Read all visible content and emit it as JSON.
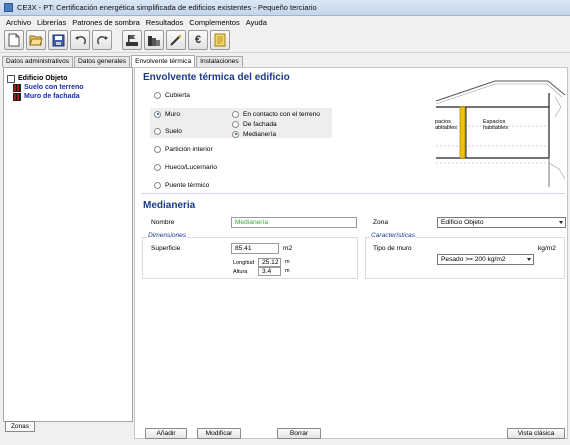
{
  "window": {
    "title": "CE3X - PT: Certificación energética simplificada de edificios existentes - Pequeño terciario"
  },
  "menu": [
    "Archivo",
    "Librerías",
    "Patrones de sombra",
    "Resultados",
    "Complementos",
    "Ayuda"
  ],
  "toolbar": {
    "icons": [
      "new-file-icon",
      "open-folder-icon",
      "save-icon",
      "undo-icon",
      "redo-icon",
      "building-flag-icon",
      "building-levels-icon",
      "magic-wand-icon",
      "euro-icon",
      "document-icon"
    ],
    "euro_symbol": "€"
  },
  "tabs": [
    "Datos administrativos",
    "Datos generales",
    "Envolvente térmica",
    "Instalaciones"
  ],
  "active_tab": "Envolvente térmica",
  "tree": {
    "root": "Edificio Objeto",
    "children": [
      "Suelo con terreno",
      "Muro de fachada"
    ]
  },
  "zonas_button": "Zonas",
  "envelope": {
    "title": "Envolvente térmica del edificio",
    "options": [
      "Cubierta",
      "Muro",
      "Suelo",
      "Partición interior",
      "Hueco/Lucernario",
      "Puente térmico"
    ],
    "selected": "Muro",
    "muro_suboptions": [
      "En contacto con el terreno",
      "De fachada",
      "Medianería"
    ],
    "muro_selected": "Medianería",
    "diagram_labels": {
      "left": [
        "pacios",
        "abitables"
      ],
      "right": [
        "Espacios",
        "habitables"
      ]
    }
  },
  "detail": {
    "title": "Medianeria",
    "nombre_label": "Nombre",
    "nombre_value": "Medianería",
    "zona_label": "Zona",
    "zona_value": "Edificio Objeto",
    "dimensiones_legend": "Dimensiones",
    "superficie_label": "Superficie",
    "superficie_value": "85.41",
    "superficie_unit": "m2",
    "longitud_label": "Longitud",
    "longitud_value": "25.12",
    "longitud_unit": "m",
    "altura_label": "Altura",
    "altura_value": "3.4",
    "altura_unit": "m",
    "caracteristicas_legend": "Características",
    "tipo_muro_label": "Tipo de muro",
    "tipo_muro_value": "Pesado >= 200 kg/m2",
    "tipo_muro_unit": "kg/m2"
  },
  "buttons": {
    "anadir": "Añadir",
    "modificar": "Modificar",
    "borrar": "Borrar",
    "vista_clasica": "Vista clásica"
  },
  "colors": {
    "title_blue": "#1c3a8a",
    "name_green": "#3aa63a",
    "wall_red": "#b31313",
    "insulation_yellow": "#f2c200"
  }
}
